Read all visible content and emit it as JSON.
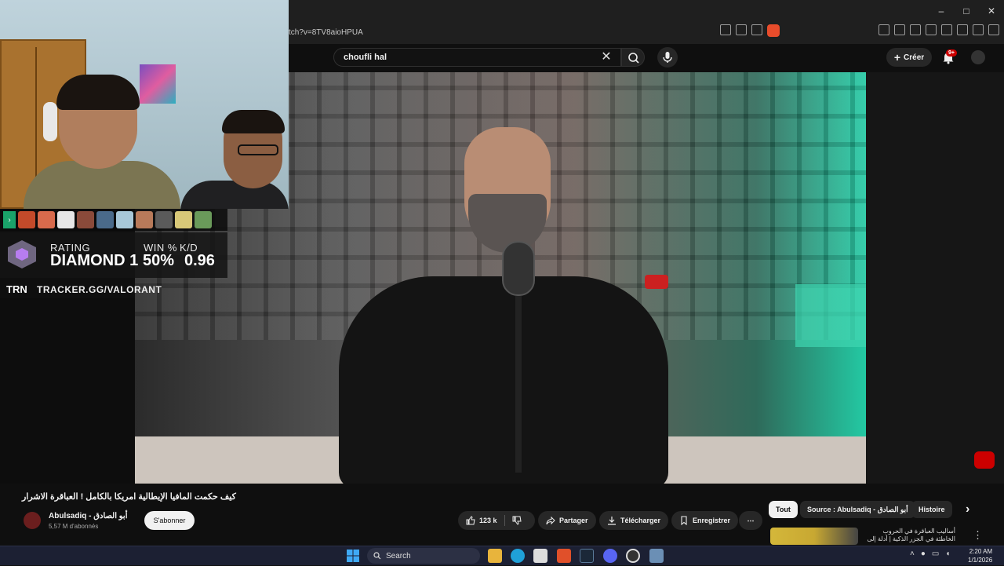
{
  "browser": {
    "url": "tch?v=8TV8aioHPUA",
    "window_controls": [
      "–",
      "□",
      "✕"
    ]
  },
  "youtube_header": {
    "search_query": "choufli hal",
    "create_label": "Créer",
    "notification_count": "9+"
  },
  "overlay": {
    "rating_label": "RATING",
    "rating_value": "DIAMOND 1",
    "win_label": "WIN %",
    "win_value": "50%",
    "kd_label": "K/D",
    "kd_value": "0.96",
    "brand": "TRN",
    "tracker_url": "TRACKER.GG/VALORANT",
    "agent_colors": [
      "#c44a2a",
      "#d86a4c",
      "#e6e6e6",
      "#8a4a3a",
      "#4a6a8a",
      "#a8c8d8",
      "#b87a5a",
      "#5a5a5a",
      "#d8c878",
      "#6a9a5a"
    ]
  },
  "video": {
    "title": "كيف حكمت المافيا الإيطالية امريكا بالكامل ! العباقرة الاشرار",
    "channel_name": "Abulsadiq - أبو الصادق",
    "subscribers": "5,57 M d'abonnés",
    "subscribe_label": "S'abonner",
    "likes": "123 k",
    "share_label": "Partager",
    "download_label": "Télécharger",
    "save_label": "Enregistrer",
    "more_label": "⋯"
  },
  "chips": {
    "all": "Tout",
    "source": "Source : Abulsadiq - أبو الصادق",
    "history": "Histoire",
    "next_arrow": "›"
  },
  "recommendation": {
    "title": "أساليب العباقرة في الحروب الخاطئة في الجزر الذكية | أدلة إلى ..."
  },
  "taskbar": {
    "search_label": "Search",
    "time": "2:20 AM",
    "date": "1/1/2026"
  },
  "colors": {
    "yt_red": "#cc0000",
    "accent_green": "#1aa36a"
  }
}
